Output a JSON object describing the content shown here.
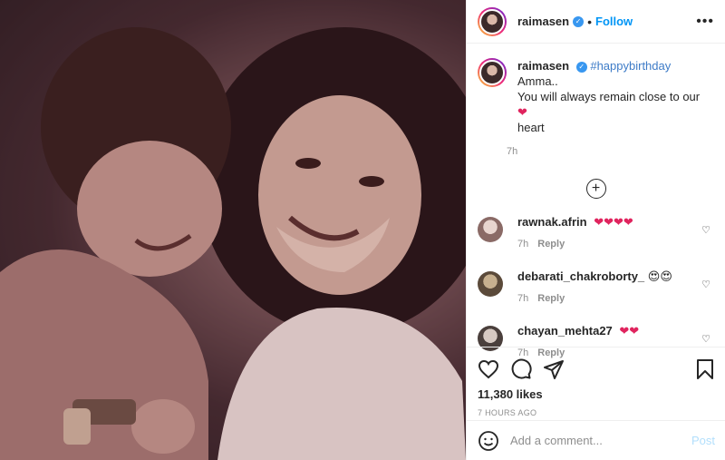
{
  "post": {
    "author": "raimasen",
    "follow_label": "Follow",
    "more_label": "•••",
    "caption": {
      "username": "raimasen",
      "hashtag": "#happybirthday",
      "text_a": " Amma..",
      "text_b": "You will always remain close to our",
      "emoji": "❤",
      "text_c": "heart",
      "time": "7h"
    },
    "load_more_label": "+",
    "comments": [
      {
        "username": "rawnak.afrin",
        "emoji": "❤❤❤❤",
        "time": "7h",
        "reply": "Reply"
      },
      {
        "username": "debarati_chakroborty_",
        "emoji": "😍😍",
        "time": "7h",
        "reply": "Reply"
      },
      {
        "username": "chayan_mehta27",
        "emoji": "❤❤",
        "time": "7h",
        "reply": "Reply"
      }
    ],
    "likes": "11,380 likes",
    "posted": "7 HOURS AGO",
    "add_comment_placeholder": "Add a comment...",
    "post_label": "Post"
  },
  "icons": [
    "heart-icon",
    "comment-icon",
    "share-icon",
    "save-icon",
    "emoji-icon",
    "verified-icon",
    "plus-circle-icon"
  ],
  "colors": {
    "link": "#0095f6",
    "verified": "#3897f0",
    "muted": "#8e8e8e",
    "post_disabled": "#b2dffc"
  }
}
